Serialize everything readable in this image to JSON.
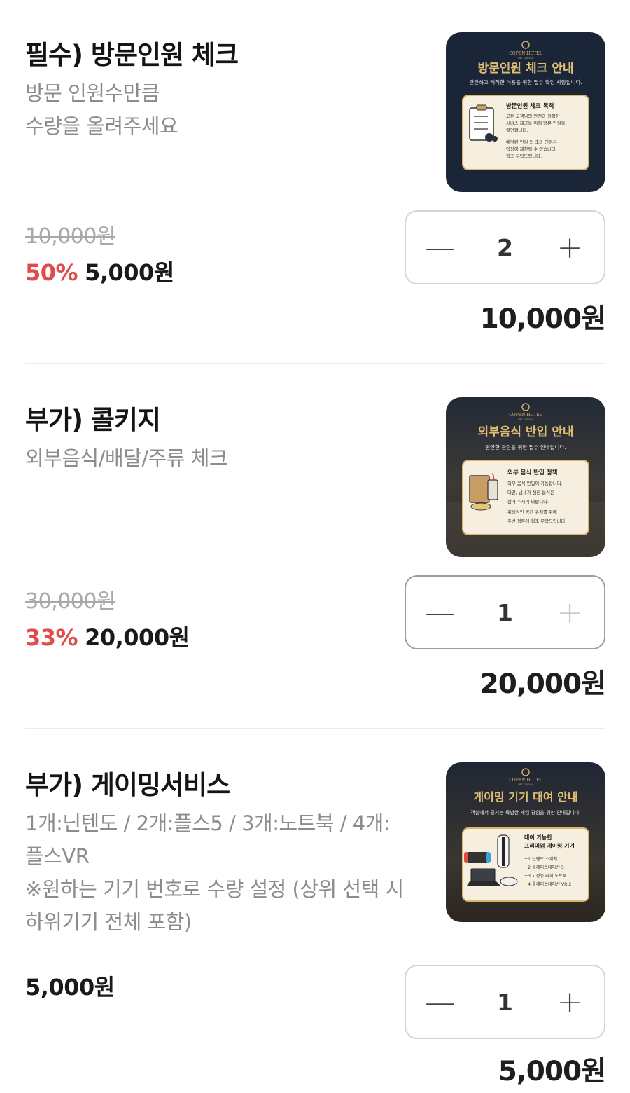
{
  "colors": {
    "accent_red": "#e04b4b",
    "text_dark": "#141414",
    "text_gray": "#8c8c8c",
    "thumb_bg": "#1b2538",
    "gold": "#d8b56a"
  },
  "items": [
    {
      "title": "필수) 방문인원 체크",
      "desc": [
        "방문 인원수만큼",
        "수량을 올려주세요"
      ],
      "original_price": "10,000원",
      "discount": "50%",
      "sale_price": "5,000원",
      "quantity": "2",
      "total": "10,000원",
      "thumb": {
        "brand": "COPEN HOTEL",
        "brand_sub": "PET CINEMA",
        "headline": "방문인원 체크 안내",
        "subline": "안전하고 쾌적한 이용을 위한 필수 확인 사항입니다.",
        "card_title": "방문인원 체크 목적",
        "card_lines": [
          "모든 고객님의 안전과 원활한",
          "서비스 제공을 위해 방문 인원을",
          "확인합니다.",
          "예약된 인원 외 초과 인원은",
          "입장이 제한될 수 있습니다.",
          "협조 부탁드립니다."
        ],
        "icon": "clipboard-icon"
      }
    },
    {
      "title": "부가) 콜키지",
      "desc": [
        "외부음식/배달/주류 체크"
      ],
      "original_price": "30,000원",
      "discount": "33%",
      "sale_price": "20,000원",
      "quantity": "1",
      "total": "20,000원",
      "thumb": {
        "brand": "COPEN HOTEL",
        "brand_sub": "PET CINEMA",
        "headline": "외부음식 반입 안내",
        "subline": "편안한 관람을 위한 필수 안내입니다.",
        "card_title": "외부 음식 반입 정책",
        "card_lines": [
          "외부 음식 반입이 가능합니다.",
          "다만, 냄새가 심한 음식은",
          "삼가 주시기 바랍니다.",
          "위생적인 공간 유지를 위해",
          "주변 정돈에 협조 부탁드립니다."
        ],
        "icon": "food-bag-icon"
      }
    },
    {
      "title": "부가) 게이밍서비스",
      "desc": [
        "1개:닌텐도 / 2개:플스5 / 3개:노트북 / 4개:",
        "플스VR",
        "※원하는 기기 번호로 수량 설정 (상위 선택 시",
        "하위기기 전체 포함)"
      ],
      "price": "5,000원",
      "quantity": "1",
      "total": "5,000원",
      "thumb": {
        "brand": "COPEN HOTEL",
        "brand_sub": "PET CINEMA",
        "headline": "게이밍 기기 대여 안내",
        "subline": "객실에서 즐기는 특별한 게임 경험을 위한 안내입니다.",
        "card_title": "대여 가능한",
        "card_title2": "프리미엄 게이밍 기기",
        "card_lines": [
          "+1 닌텐도 스위치",
          "+2 플레이스테이션 5",
          "+3 고성능 터치 노트북",
          "+4 플레이스테이션 VR 2"
        ],
        "icon": "game-console-icon"
      }
    }
  ],
  "stepper": {
    "minus_symbol": "—",
    "plus_symbol": "+"
  }
}
